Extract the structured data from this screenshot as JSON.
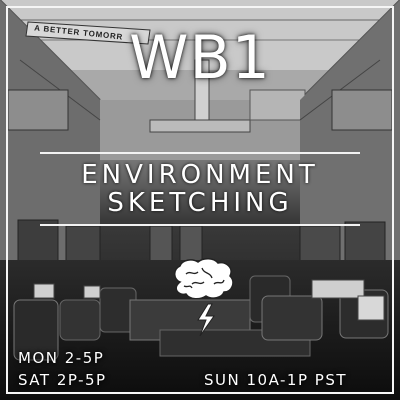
{
  "poster": {
    "sign_text": "A BETTER TOMORR",
    "code": "WB1",
    "title_line1": "ENVIRONMENT",
    "title_line2": "SKETCHING",
    "schedule": {
      "line1": "MON 2-5P",
      "line2": "SAT 2P-5P",
      "line3": "SUN 10A-1P PST"
    },
    "icon": "brain-lightning-icon",
    "colors": {
      "text": "#ffffff",
      "frame": "#f5f5f5",
      "background": "#1a1a1a"
    }
  }
}
